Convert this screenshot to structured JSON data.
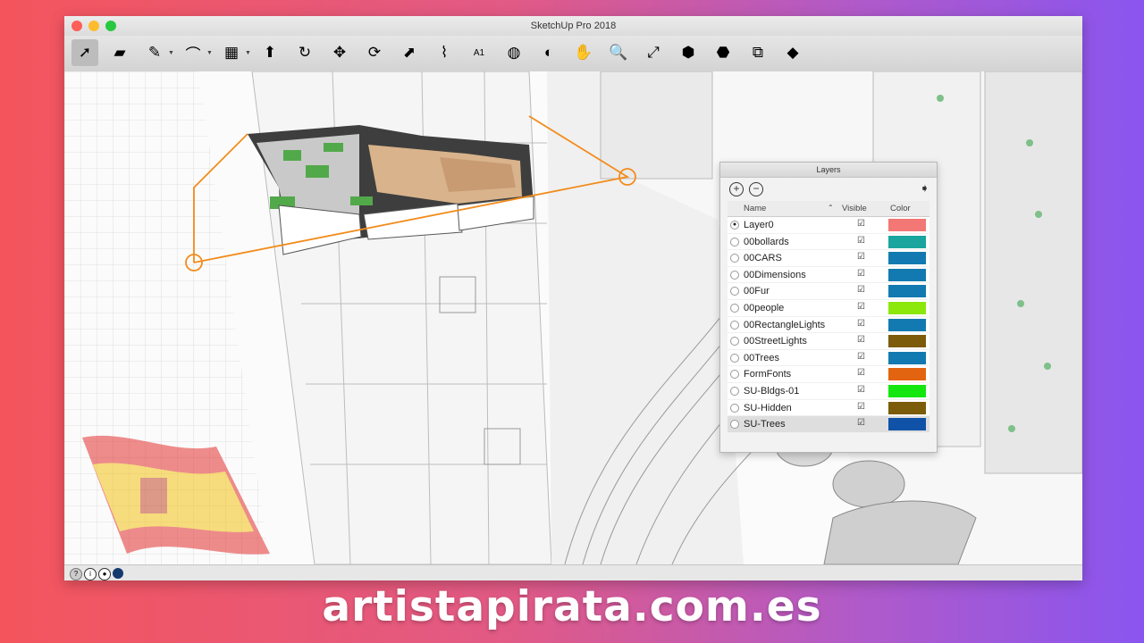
{
  "window": {
    "title": "SketchUp Pro 2018"
  },
  "toolbar": {
    "tools": [
      {
        "name": "select-tool",
        "glyph": "➚"
      },
      {
        "name": "eraser-tool",
        "glyph": "▰"
      },
      {
        "name": "pencil-tool",
        "glyph": "✎"
      },
      {
        "name": "arc-tool",
        "glyph": "⌒"
      },
      {
        "name": "rectangle-tool",
        "glyph": "▦"
      },
      {
        "name": "push-pull-tool",
        "glyph": "⬆"
      },
      {
        "name": "follow-me-tool",
        "glyph": "↻"
      },
      {
        "name": "move-tool",
        "glyph": "✥"
      },
      {
        "name": "rotate-tool",
        "glyph": "⟳"
      },
      {
        "name": "scale-tool",
        "glyph": "⬈"
      },
      {
        "name": "tape-measure-tool",
        "glyph": "⌇"
      },
      {
        "name": "text-tool",
        "glyph": "A1"
      },
      {
        "name": "paint-bucket-tool",
        "glyph": "◍"
      },
      {
        "name": "orbit-tool",
        "glyph": "◐"
      },
      {
        "name": "pan-tool",
        "glyph": "✋"
      },
      {
        "name": "zoom-tool",
        "glyph": "🔍"
      },
      {
        "name": "zoom-extents-tool",
        "glyph": "⤢"
      },
      {
        "name": "warehouse-tool",
        "glyph": "⬢"
      },
      {
        "name": "extension-warehouse-tool",
        "glyph": "⬣"
      },
      {
        "name": "layout-tool",
        "glyph": "⧉"
      },
      {
        "name": "ruby-tool",
        "glyph": "◆"
      }
    ]
  },
  "layers_panel": {
    "title": "Layers",
    "columns": {
      "name": "Name",
      "visible": "Visible",
      "color": "Color"
    },
    "layers": [
      {
        "name": "Layer0",
        "visible": true,
        "active": true,
        "color": "#f37775"
      },
      {
        "name": "00bollards",
        "visible": true,
        "active": false,
        "color": "#1aa59f"
      },
      {
        "name": "00CARS",
        "visible": true,
        "active": false,
        "color": "#127ab0"
      },
      {
        "name": "00Dimensions",
        "visible": true,
        "active": false,
        "color": "#127ab0"
      },
      {
        "name": "00Fur",
        "visible": true,
        "active": false,
        "color": "#127ab0"
      },
      {
        "name": "00people",
        "visible": true,
        "active": false,
        "color": "#8ce80a"
      },
      {
        "name": "00RectangleLights",
        "visible": true,
        "active": false,
        "color": "#127ab0"
      },
      {
        "name": "00StreetLights",
        "visible": true,
        "active": false,
        "color": "#7c5b0a"
      },
      {
        "name": "00Trees",
        "visible": true,
        "active": false,
        "color": "#127ab0"
      },
      {
        "name": "FormFonts",
        "visible": true,
        "active": false,
        "color": "#e36410"
      },
      {
        "name": "SU-Bldgs-01",
        "visible": true,
        "active": false,
        "color": "#13e70f"
      },
      {
        "name": "SU-Hidden",
        "visible": true,
        "active": false,
        "color": "#7c5b0a"
      },
      {
        "name": "SU-Trees",
        "visible": true,
        "active": false,
        "selected": true,
        "color": "#0f52a8"
      }
    ]
  },
  "footer": {
    "site": "artistapirata.com.es"
  }
}
